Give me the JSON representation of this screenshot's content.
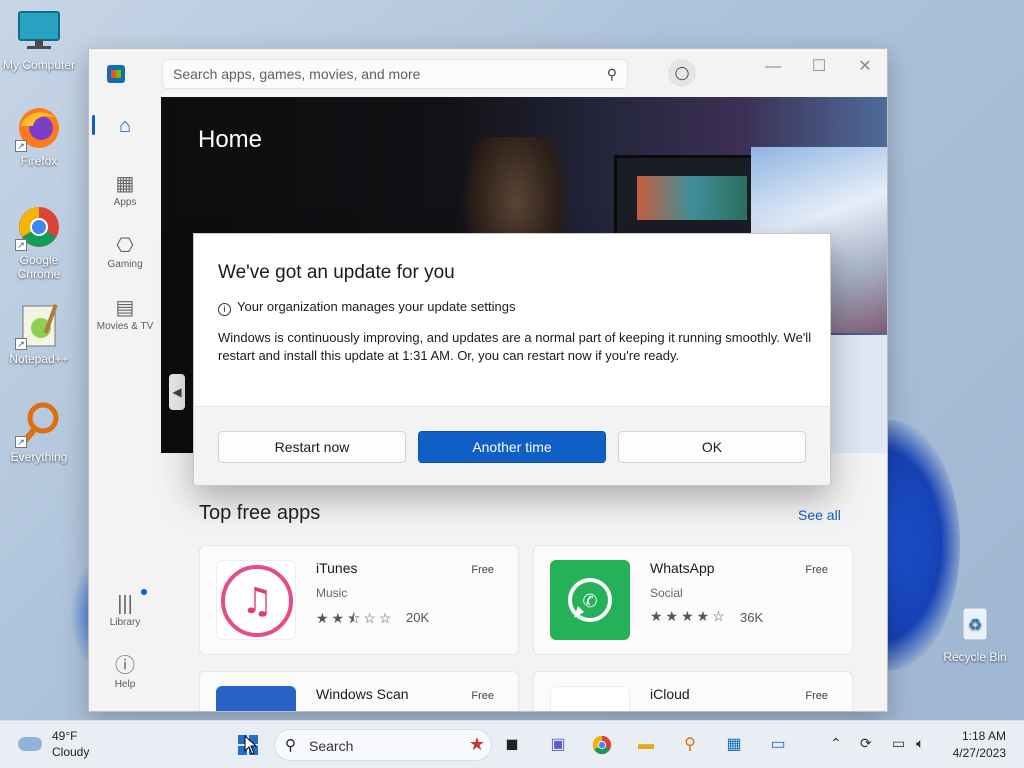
{
  "desktop": {
    "icons": [
      {
        "label": "My Computer"
      },
      {
        "label": "Firefox"
      },
      {
        "label": "Google Chrome"
      },
      {
        "label": "Notepad++"
      },
      {
        "label": "Everything"
      },
      {
        "label": "Recycle Bin"
      }
    ]
  },
  "store": {
    "search_placeholder": "Search apps, games, movies, and more",
    "nav": {
      "apps": "Apps",
      "gaming": "Gaming",
      "movies_tv": "Movies & TV",
      "library": "Library",
      "help": "Help"
    },
    "hero_title": "Home",
    "section_title": "Top free apps",
    "see_all": "See all",
    "apps": [
      {
        "name": "iTunes",
        "category": "Music",
        "price": "Free",
        "rating": 2.5,
        "stars": "★★⯪☆☆",
        "count": "20K"
      },
      {
        "name": "WhatsApp",
        "category": "Social",
        "price": "Free",
        "rating": 4,
        "stars": "★★★★☆",
        "count": "36K"
      },
      {
        "name": "Windows Scan",
        "price": "Free"
      },
      {
        "name": "iCloud",
        "price": "Free"
      }
    ]
  },
  "dialog": {
    "title": "We've got an update for you",
    "info": "Your organization manages your update settings",
    "body": "Windows is continuously improving, and updates are a normal part of keeping it running smoothly. We'll restart and install this update at 1:31 AM. Or, you can restart now if you're ready.",
    "buttons": {
      "restart": "Restart now",
      "another": "Another time",
      "ok": "OK"
    }
  },
  "taskbar": {
    "weather_temp": "49°F",
    "weather_cond": "Cloudy",
    "search_label": "Search",
    "time": "1:18 AM",
    "date": "4/27/2023"
  },
  "colors": {
    "accent": "#0f5fc6"
  }
}
